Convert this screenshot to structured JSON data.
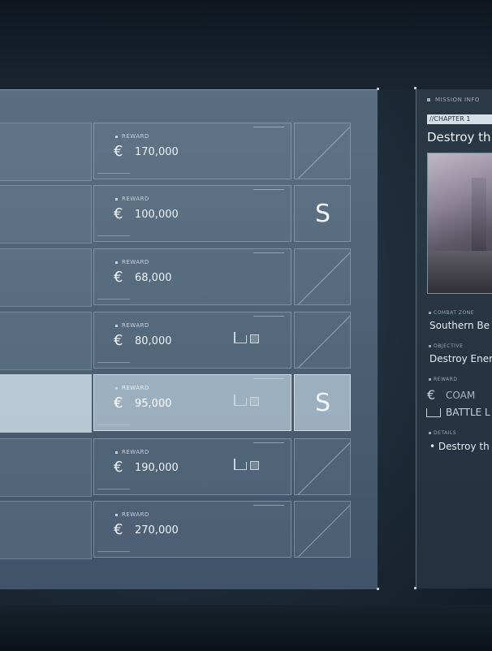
{
  "missions": [
    {
      "reward_label": "REWARD",
      "currency": "€",
      "amount": "170,000",
      "rank": "",
      "has_conditions": false,
      "selected": false
    },
    {
      "reward_label": "REWARD",
      "currency": "€",
      "amount": "100,000",
      "rank": "S",
      "has_conditions": false,
      "selected": false
    },
    {
      "reward_label": "REWARD",
      "currency": "€",
      "amount": "68,000",
      "rank": "",
      "has_conditions": false,
      "selected": false
    },
    {
      "reward_label": "REWARD",
      "currency": "€",
      "amount": "80,000",
      "rank": "",
      "has_conditions": true,
      "selected": false
    },
    {
      "reward_label": "REWARD",
      "currency": "€",
      "amount": "95,000",
      "rank": "S",
      "has_conditions": true,
      "selected": true
    },
    {
      "reward_label": "REWARD",
      "currency": "€",
      "amount": "190,000",
      "rank": "",
      "has_conditions": true,
      "selected": false
    },
    {
      "reward_label": "REWARD",
      "currency": "€",
      "amount": "270,000",
      "rank": "",
      "has_conditions": false,
      "selected": false
    }
  ],
  "info": {
    "header": "MISSION INFO",
    "chapter": "//CHAPTER 1",
    "title": "Destroy th",
    "combat_zone_label": "COMBAT ZONE",
    "combat_zone_value": "Southern Be",
    "objective_label": "OBJECTIVE",
    "objective_value": "Destroy Ener",
    "reward_label": "REWARD",
    "reward_currency": "€",
    "reward_coam": "COAM",
    "reward_battle": "BATTLE L",
    "details_label": "DETAILS",
    "details_value": "• Destroy th"
  },
  "colors": {
    "selected_row": "#cddce6",
    "panel": "#4f6376",
    "info_bg": "#27343f"
  }
}
